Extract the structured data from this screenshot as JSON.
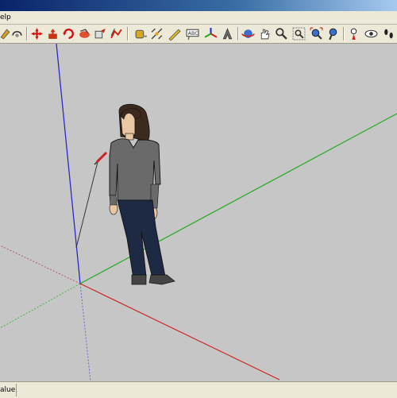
{
  "menu": {
    "help_label": "elp"
  },
  "toolbar": {
    "tools": [
      "paint-bucket-icon",
      "orbit-tool-icon",
      "move-tool-icon",
      "push-pull-tool-icon",
      "rotate-tool-icon",
      "follow-me-tool-icon",
      "scale-tool-icon",
      "offset-tool-icon",
      "tape-measure-tool-icon",
      "dimension-tool-icon",
      "protractor-tool-icon",
      "text-tool-icon",
      "axes-tool-icon",
      "3d-text-tool-icon",
      "orbit-icon",
      "pan-icon",
      "zoom-icon",
      "zoom-window-icon",
      "zoom-extents-icon",
      "previous-view-icon",
      "position-camera-icon",
      "look-around-icon",
      "walk-icon"
    ]
  },
  "viewport": {
    "axes_colors": {
      "red": "#cc2222",
      "green": "#22aa22",
      "blue": "#2222cc"
    },
    "background": "#c6c6c6",
    "figure": "person-figure"
  },
  "status": {
    "text": "alue."
  }
}
